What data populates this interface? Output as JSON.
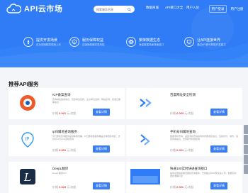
{
  "header": {
    "logo_text": "API云市场",
    "search_placeholder": "搜索服务名称",
    "menu": [
      "数据商城",
      "API接口大全",
      "用户入驻"
    ],
    "buttons": [
      "用户登录",
      "用户注册"
    ]
  },
  "features": [
    {
      "title": "提供开发场景",
      "sub": "成功调用随意调用上手",
      "icon": "rocket-icon"
    },
    {
      "title": "服务保障权益",
      "sub": "正版授权服务零风险",
      "icon": "shield-icon"
    },
    {
      "title": "繁荣数据生态",
      "sub": "海量数据场景快速接口",
      "icon": "atom-icon"
    },
    {
      "title": "让API连接世界",
      "sub": "通过API即可获取开发能力",
      "icon": "link-icon"
    }
  ],
  "section_title": "推荐API服务",
  "cards": [
    {
      "name": "ICP备案查询",
      "desc": "查询域名备案信息，包含单位名称，主办单位性质，网站名称，批准日期等信息",
      "price": "0.001",
      "unit": "元/次起",
      "button": "查看详情",
      "icon": "icp-logo-icon"
    },
    {
      "name": "百度网址安全检测",
      "desc": "",
      "price": "0.003",
      "unit": "元/次起",
      "button": "查看详情",
      "icon": "baidu-check-icon"
    },
    {
      "name": "ip归属地查询服务",
      "desc": "IP归属地查询服务提供精准准确，IP归属地数据库覆盖全球国家地区，支持IPv4与IPv6双栈查询",
      "price": "0.001",
      "unit": "元/次起",
      "button": "查看详情",
      "icon": "ip-icon"
    },
    {
      "name": "手机号归属地查询",
      "desc": "根据手机号码，返回手机号码运营商所属地区信息，包括省份、城市、运营商等信息，支持携号转网查询",
      "price": "0.001",
      "unit": "元/次起",
      "button": "查看详情",
      "icon": "phone-icon"
    },
    {
      "name": "DeepL翻译",
      "desc": "DeepL翻译API",
      "price": "0.003",
      "unit": "元/次起",
      "button": "查看详情",
      "icon": "deepl-icon"
    },
    {
      "name": "快递100实时快递查询接口",
      "desc": "提供全国快递物流跟踪查询服务，支持超过2000家快递公司，数据实时更新准确可靠",
      "price": "0.001",
      "unit": "元/次起",
      "button": "查看详情",
      "icon": "express-icon"
    }
  ],
  "colors": {
    "brand": "#2f7cf6",
    "price": "#e0403d",
    "button": "#3a7ef5"
  }
}
